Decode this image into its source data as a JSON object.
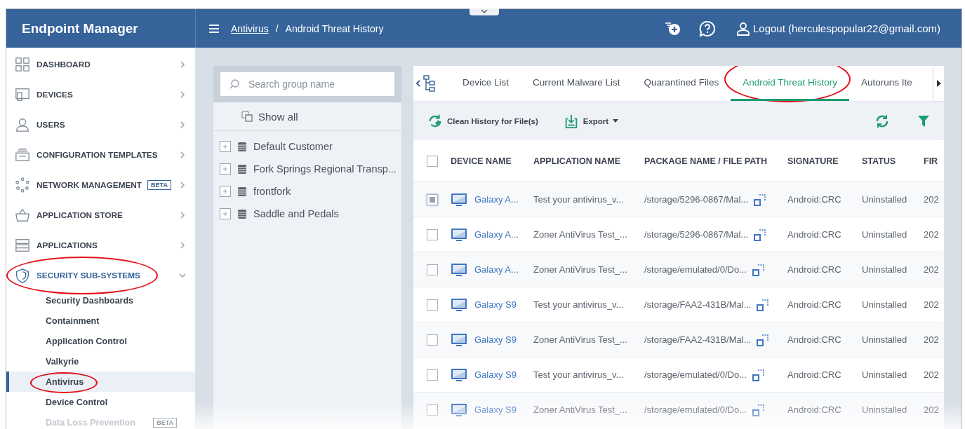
{
  "header": {
    "title": "Endpoint Manager",
    "breadcrumb_link": "Antivirus",
    "breadcrumb_separator": "/",
    "breadcrumb_current": "Android Threat History",
    "logout": "Logout (herculespopular22@gmail.com)"
  },
  "sidebar": {
    "items": [
      {
        "label": "DASHBOARD",
        "expanded": false,
        "circled": false
      },
      {
        "label": "DEVICES",
        "expanded": false,
        "circled": false
      },
      {
        "label": "USERS",
        "expanded": false,
        "circled": false
      },
      {
        "label": "CONFIGURATION TEMPLATES",
        "expanded": false,
        "circled": false
      },
      {
        "label": "NETWORK MANAGEMENT",
        "badge": "BETA",
        "expanded": false,
        "circled": false
      },
      {
        "label": "APPLICATION STORE",
        "expanded": false,
        "circled": false
      },
      {
        "label": "APPLICATIONS",
        "expanded": false,
        "circled": false
      },
      {
        "label": "SECURITY SUB-SYSTEMS",
        "expanded": true,
        "circled": true,
        "children": [
          {
            "label": "Security Dashboards",
            "selected": false,
            "disabled": false,
            "circled": false
          },
          {
            "label": "Containment",
            "selected": false,
            "disabled": false,
            "circled": false
          },
          {
            "label": "Application Control",
            "selected": false,
            "disabled": false,
            "circled": false
          },
          {
            "label": "Valkyrie",
            "selected": false,
            "disabled": false,
            "circled": false
          },
          {
            "label": "Antivirus",
            "selected": true,
            "disabled": false,
            "circled": true
          },
          {
            "label": "Device Control",
            "selected": false,
            "disabled": false,
            "circled": false
          },
          {
            "label": "Data Loss Prevention",
            "badge": "BETA",
            "selected": false,
            "disabled": true,
            "circled": false
          }
        ]
      }
    ]
  },
  "groups": {
    "search": {
      "placeholder": "Search group name"
    },
    "show_all": "Show all",
    "items": [
      {
        "label": "Default Customer"
      },
      {
        "label": "Fork Springs Regional Transp..."
      },
      {
        "label": "frontfork"
      },
      {
        "label": "Saddle and Pedals"
      }
    ]
  },
  "tabs": [
    {
      "label": "Device List",
      "selected": false,
      "circled": false
    },
    {
      "label": "Current Malware List",
      "selected": false,
      "circled": false
    },
    {
      "label": "Quarantined Files",
      "selected": false,
      "circled": false
    },
    {
      "label": "Android Threat History",
      "selected": true,
      "circled": true
    },
    {
      "label": "Autoruns Ite",
      "selected": false,
      "circled": false
    }
  ],
  "toolbar": {
    "clean": "Clean History for File(s)",
    "export": "Export"
  },
  "table": {
    "select_all_checked": false,
    "columns": [
      "DEVICE NAME",
      "APPLICATION NAME",
      "PACKAGE NAME / FILE PATH",
      "SIGNATURE",
      "STATUS",
      "FIR"
    ],
    "rows": [
      {
        "checked": true,
        "device": "Galaxy A...",
        "application": "Test your antivirus_v...",
        "path": "/storage/5296-0867/Mal...",
        "signature": "Android:CRC",
        "status": "Uninstalled",
        "column_6": "202"
      },
      {
        "checked": false,
        "device": "Galaxy A...",
        "application": "Zoner AntiVirus Test_...",
        "path": "/storage/5296-0867/Mal...",
        "signature": "Android:CRC",
        "status": "Uninstalled",
        "column_6": "202"
      },
      {
        "checked": false,
        "device": "Galaxy A...",
        "application": "Zoner AntiVirus Test_...",
        "path": "/storage/emulated/0/Do...",
        "signature": "Android:CRC",
        "status": "Uninstalled",
        "column_6": "202"
      },
      {
        "checked": false,
        "device": "Galaxy S9",
        "application": "Test your antivirus_v...",
        "path": "/storage/FAA2-431B/Mal...",
        "signature": "Android:CRC",
        "status": "Uninstalled",
        "column_6": "202"
      },
      {
        "checked": false,
        "device": "Galaxy S9",
        "application": "Zoner AntiVirus Test_...",
        "path": "/storage/FAA2-431B/Mal...",
        "signature": "Android:CRC",
        "status": "Uninstalled",
        "column_6": "202"
      },
      {
        "checked": false,
        "device": "Galaxy S9",
        "application": "Test your antivirus_v...",
        "path": "/storage/emulated/0/Do...",
        "signature": "Android:CRC",
        "status": "Uninstalled",
        "column_6": "202"
      },
      {
        "checked": false,
        "device": "Galaxy S9",
        "application": "Zoner AntiVirus Test_...",
        "path": "/storage/emulated/0/Do...",
        "signature": "Android:CRC",
        "status": "Uninstalled",
        "column_6": "202"
      }
    ]
  }
}
